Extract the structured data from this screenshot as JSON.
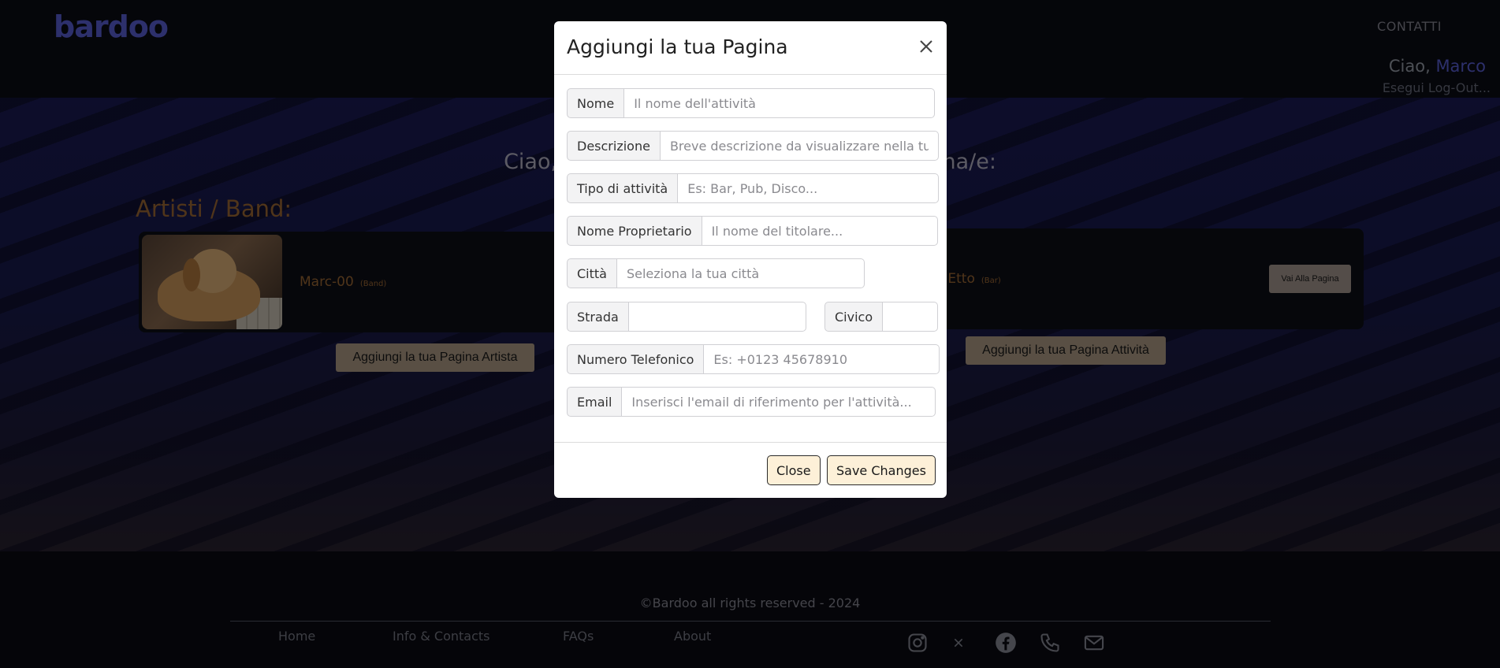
{
  "header": {
    "logo": "bardoo",
    "contatti": "CONTATTI",
    "greeting_prefix": "Ciao,",
    "user_name": "Marco",
    "logout": "Esegui Log-Out..."
  },
  "hero": {
    "title_left": "Ciao,",
    "title_right": "agina/e:",
    "section_label": "Artisti / Band:",
    "artist_card": {
      "name": "Marc-00",
      "tag": "(Band)"
    },
    "venue_card": {
      "name": "r Etto",
      "tag": "(Bar)",
      "button": "Vai Alla Pagina"
    },
    "add_artist_button": "Aggiungi la tua Pagina Artista",
    "add_venue_button": "Aggiungi la tua Pagina Attività"
  },
  "modal": {
    "title": "Aggiungi la tua Pagina",
    "fields": {
      "nome": {
        "label": "Nome",
        "placeholder": "Il nome dell'attività"
      },
      "descrizione": {
        "label": "Descrizione",
        "placeholder": "Breve descrizione da visualizzare nella tua pagina"
      },
      "tipo": {
        "label": "Tipo di attività",
        "placeholder": "Es: Bar, Pub, Disco..."
      },
      "proprietario": {
        "label": "Nome Proprietario",
        "placeholder": "Il nome del titolare..."
      },
      "citta": {
        "label": "Città",
        "placeholder": "Seleziona la tua città"
      },
      "strada": {
        "label": "Strada",
        "placeholder": ""
      },
      "civico": {
        "label": "Civico",
        "placeholder": ""
      },
      "telefono": {
        "label": "Numero Telefonico",
        "placeholder": "Es: +0123 45678910"
      },
      "email": {
        "label": "Email",
        "placeholder": "Inserisci l'email di riferimento per l'attività..."
      }
    },
    "close_button": "Close",
    "save_button": "Save Changes"
  },
  "footer": {
    "copyright": "©Bardoo all rights reserved - 2024",
    "links": [
      "Home",
      "Info & Contacts",
      "FAQs",
      "About"
    ],
    "social_icons": [
      "instagram-icon",
      "x-icon",
      "facebook-icon",
      "phone-icon",
      "mail-icon"
    ]
  },
  "colors": {
    "brand": "#5a60d8",
    "accent_orange": "#a06a35",
    "button_beige": "#b29e88",
    "modal_button_bg": "#fdf0d8"
  }
}
